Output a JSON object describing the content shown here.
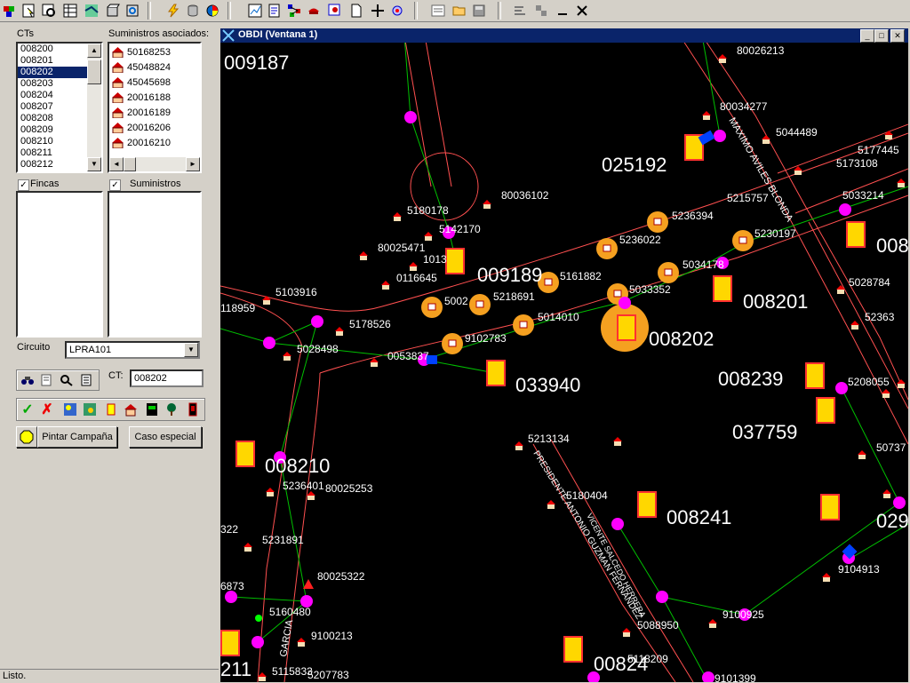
{
  "toolbar": {
    "icons": [
      "layers-icon",
      "select-icon",
      "identify-icon",
      "table-icon",
      "map-icon",
      "box-icon",
      "refresh-icon",
      "lightning-icon",
      "database-icon",
      "pie-icon",
      "graph-icon",
      "edit-icon",
      "network-icon",
      "config-icon",
      "document-icon",
      "crosshair-icon",
      "target-icon",
      "list-icon",
      "folder-open-icon",
      "save-icon",
      "flow-icon",
      "flow2-icon",
      "minimize-icon",
      "close-icon"
    ]
  },
  "left": {
    "cts_label": "CTs",
    "suministros_label": "Suministros asociados:",
    "cts": [
      "008200",
      "008201",
      "008202",
      "008203",
      "008204",
      "008207",
      "008208",
      "008209",
      "008210",
      "008211",
      "008212"
    ],
    "cts_selected": "008202",
    "suministros": [
      "50168253",
      "45048824",
      "45045698",
      "20016188",
      "20016189",
      "20016206",
      "20016210"
    ],
    "fincas_label": "Fincas",
    "suministros_check_label": "Suministros",
    "circuito_label": "Circuito",
    "circuito_value": "LPRA101",
    "ct_label": "CT:",
    "ct_value": "008202",
    "pintar_label": "Pintar Campaña",
    "caso_label": "Caso especial"
  },
  "window": {
    "title": "OBDI  (Ventana 1)"
  },
  "map": {
    "labels": {
      "l1": "009187",
      "l2": "80026213",
      "l3": "80034277",
      "l4": "5044489",
      "l5": "5177445",
      "l6": "025192",
      "l7": "5173108",
      "l8": "5033214",
      "l9": "5180178",
      "l10": "80036102",
      "l11": "5215757",
      "l12": "5236394",
      "l13": "5142170",
      "l14": "80025471",
      "l15": "1013",
      "l16": "009189",
      "l17": "5236022",
      "l18": "5230197",
      "l19": "0116645",
      "l20": "5161882",
      "l21": "5034178",
      "l22": "5028784",
      "l23": "5103916",
      "l24": "5002",
      "l25": "5218691",
      "l26": "5033352",
      "l27": "008201",
      "l28": "118959",
      "l29": "5178526",
      "l30": "5014010",
      "l31": "008202",
      "l32": "52363",
      "l33": "5028498",
      "l34": "9102783",
      "l35": "0053837",
      "l36": "033940",
      "l37": "008239",
      "l38": "5208055",
      "l39": "037759",
      "l40": "5213134",
      "l41": "50737",
      "l42": "008210",
      "l43": "5236401",
      "l44": "80025253",
      "l45": "5180404",
      "l46": "008241",
      "l47": "0292",
      "l48": "322",
      "l49": "5231891",
      "l50": "9104913",
      "l51": "80025322",
      "l52": "6873",
      "l53": "5160480",
      "l54": "9100925",
      "l55": "5088950",
      "l56": "9100213",
      "l57": "5118209",
      "l58": "00824",
      "l59": "211",
      "l60": "5115833",
      "l61": "5207783",
      "l62": "9101399",
      "l63": "MAXIMO AVILES BLONDA",
      "l64": "PRESIDENTE ANTONIO GUZMAN FERNANDEZ",
      "l65": "GARCIA",
      "l66": "VICENTE SALCEDO HERRERA",
      "l67": "008"
    }
  },
  "status": {
    "text": "Listo."
  },
  "colors": {
    "accent": "#0a246a",
    "map_bg": "#000000",
    "orange": "#f5a020",
    "magenta": "#ff00ff"
  }
}
